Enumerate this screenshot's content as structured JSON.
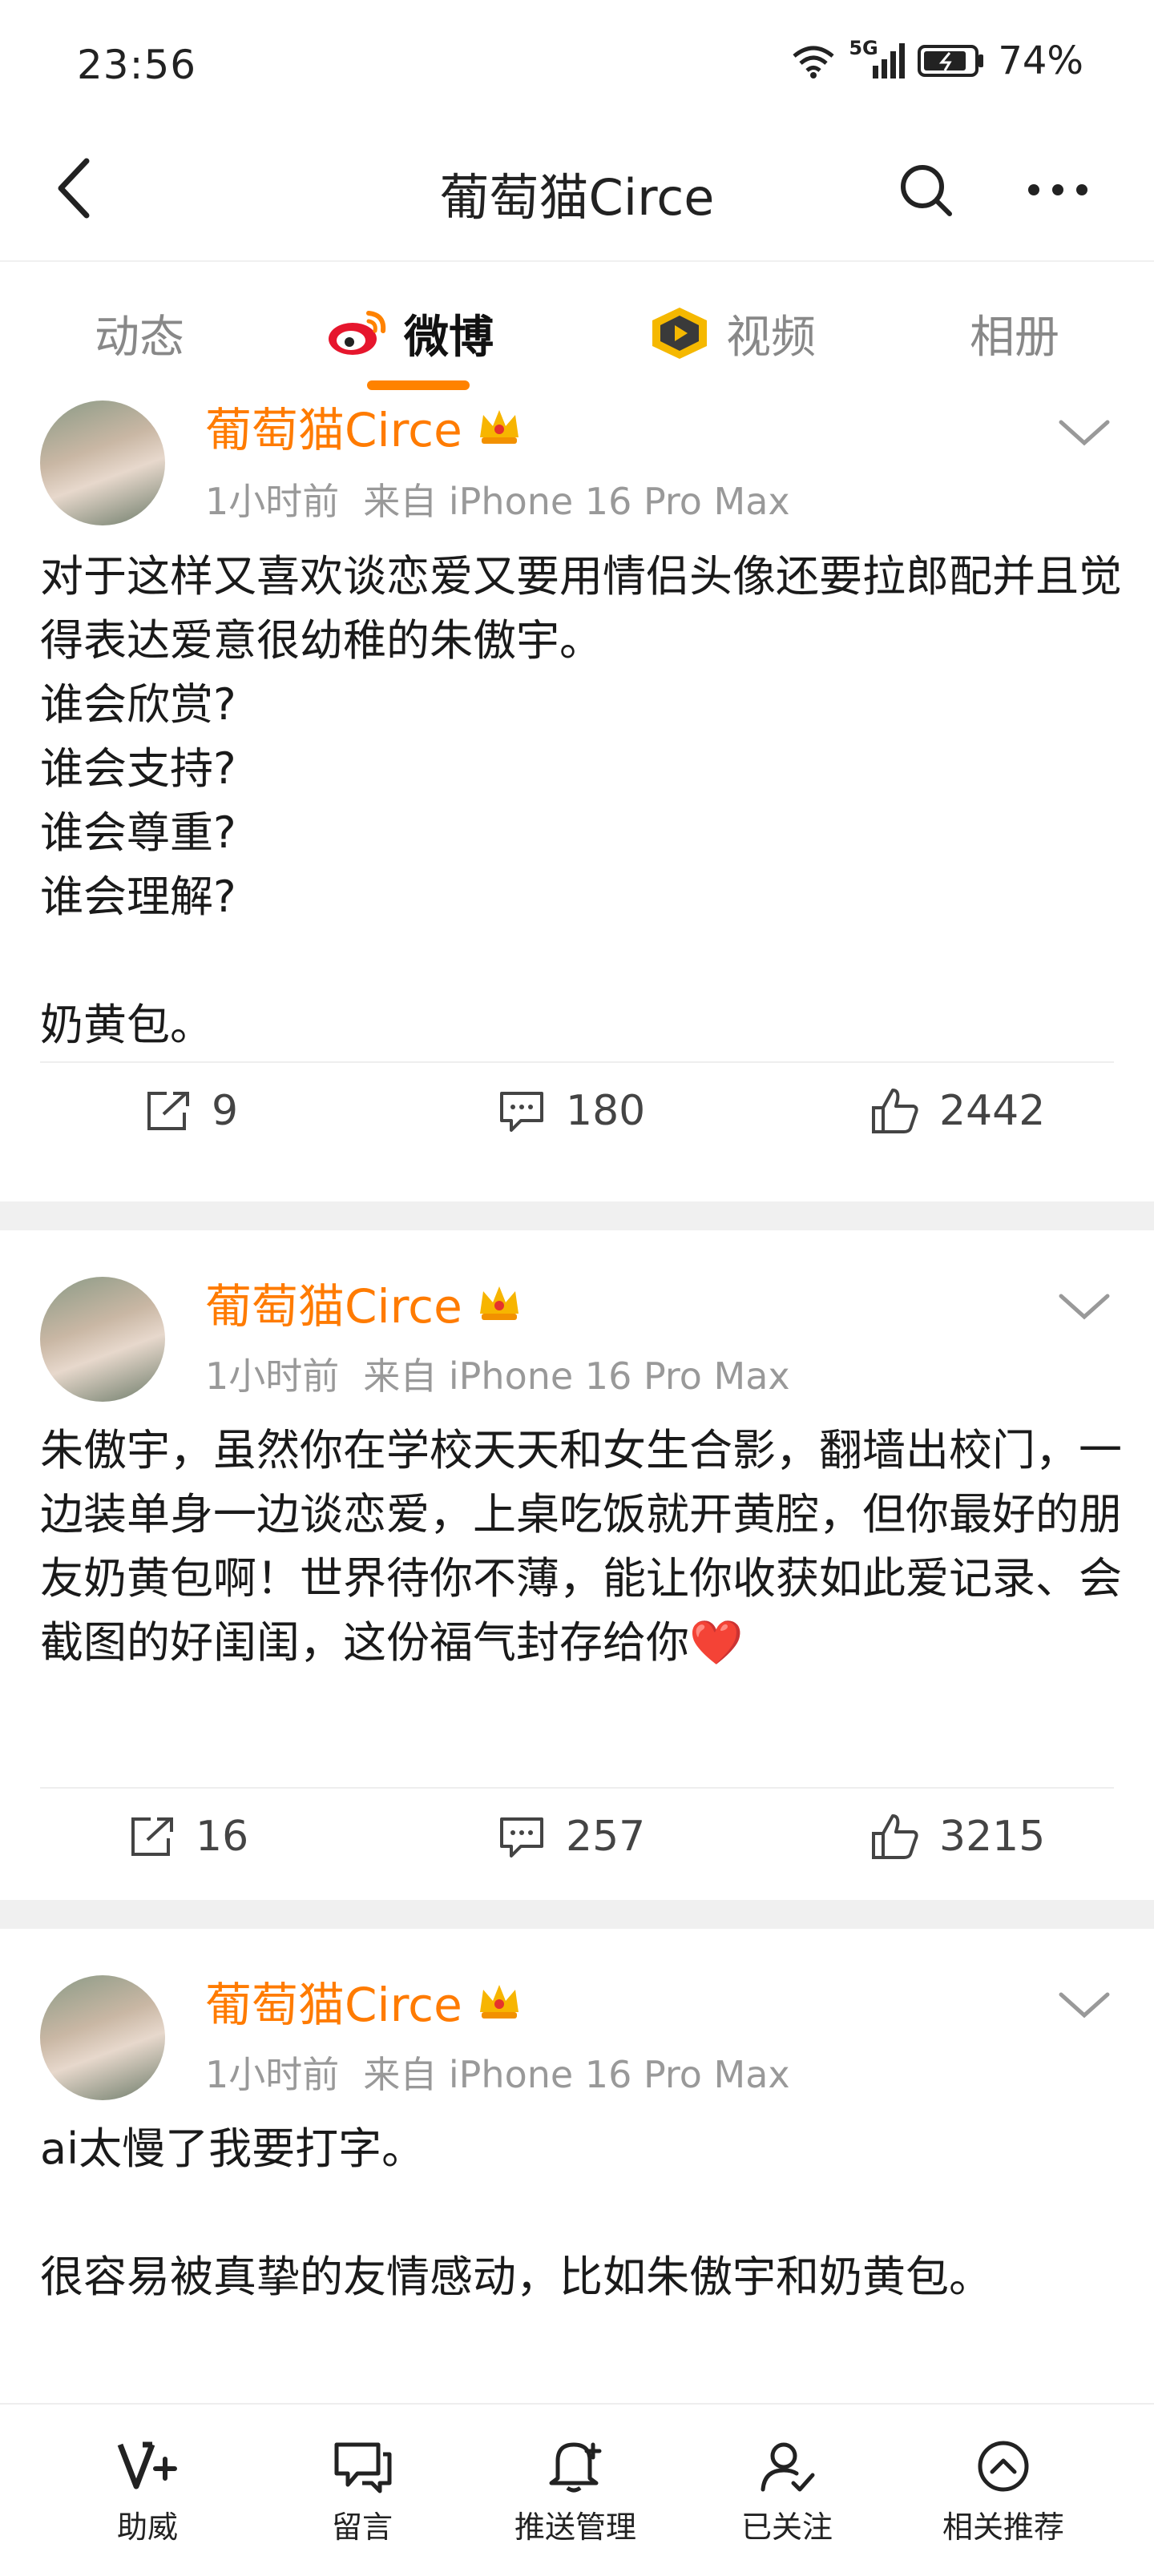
{
  "status": {
    "time": "23:56",
    "network": "5G",
    "battery": "74%"
  },
  "nav": {
    "title": "葡萄猫Circe"
  },
  "tabs": [
    {
      "label": "动态"
    },
    {
      "label": "微博"
    },
    {
      "label": "视频"
    },
    {
      "label": "相册"
    }
  ],
  "posts": [
    {
      "author": "葡萄猫Circe",
      "time": "1小时前",
      "source": "来自 iPhone 16 Pro Max",
      "text": "对于这样又喜欢谈恋爱又要用情侣头像还要拉郎配并且觉得表达爱意很幼稚的朱傲宇。\n谁会欣赏?\n谁会支持?\n谁会尊重?\n谁会理解?\n\n奶黄包。",
      "reposts": "9",
      "comments": "180",
      "likes": "2442"
    },
    {
      "author": "葡萄猫Circe",
      "time": "1小时前",
      "source": "来自 iPhone 16 Pro Max",
      "text": "朱傲宇，虽然你在学校天天和女生合影，翻墙出校门，一边装单身一边谈恋爱，上桌吃饭就开黄腔，但你最好的朋友奶黄包啊！世界待你不薄，能让你收获如此爱记录、会截图的好闺闺，这份福气封存给你❤️",
      "reposts": "16",
      "comments": "257",
      "likes": "3215"
    },
    {
      "author": "葡萄猫Circe",
      "time": "1小时前",
      "source": "来自 iPhone 16 Pro Max",
      "text": "ai太慢了我要打字。\n\n很容易被真挚的友情感动，比如朱傲宇和奶黄包。"
    }
  ],
  "bottom_bar": [
    {
      "label": "助威",
      "icon": "cheer-icon"
    },
    {
      "label": "留言",
      "icon": "message-icon"
    },
    {
      "label": "推送管理",
      "icon": "bell-icon"
    },
    {
      "label": "已关注",
      "icon": "user-check-icon"
    },
    {
      "label": "相关推荐",
      "icon": "chevron-up-circle-icon"
    }
  ],
  "colors": {
    "accent": "#ff8200",
    "author": "#ff7b00",
    "meta": "#999999"
  }
}
